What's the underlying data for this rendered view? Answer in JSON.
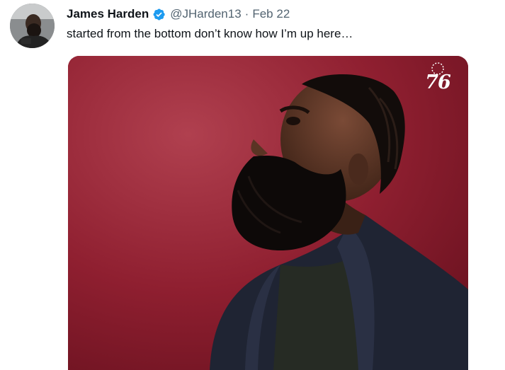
{
  "tweet": {
    "author_name": "James Harden",
    "handle": "@JHarden13",
    "separator": "·",
    "date": "Feb 22",
    "text": "started from the bottom don’t know how I’m up here…",
    "verified_icon": "verified-badge-icon",
    "media": {
      "image": "portrait-photo",
      "logo_text": "76"
    }
  },
  "colors": {
    "verified_blue": "#1d9bf0",
    "text_primary": "#0f1419",
    "text_secondary": "#536471",
    "photo_background": "#8c1a2c"
  }
}
